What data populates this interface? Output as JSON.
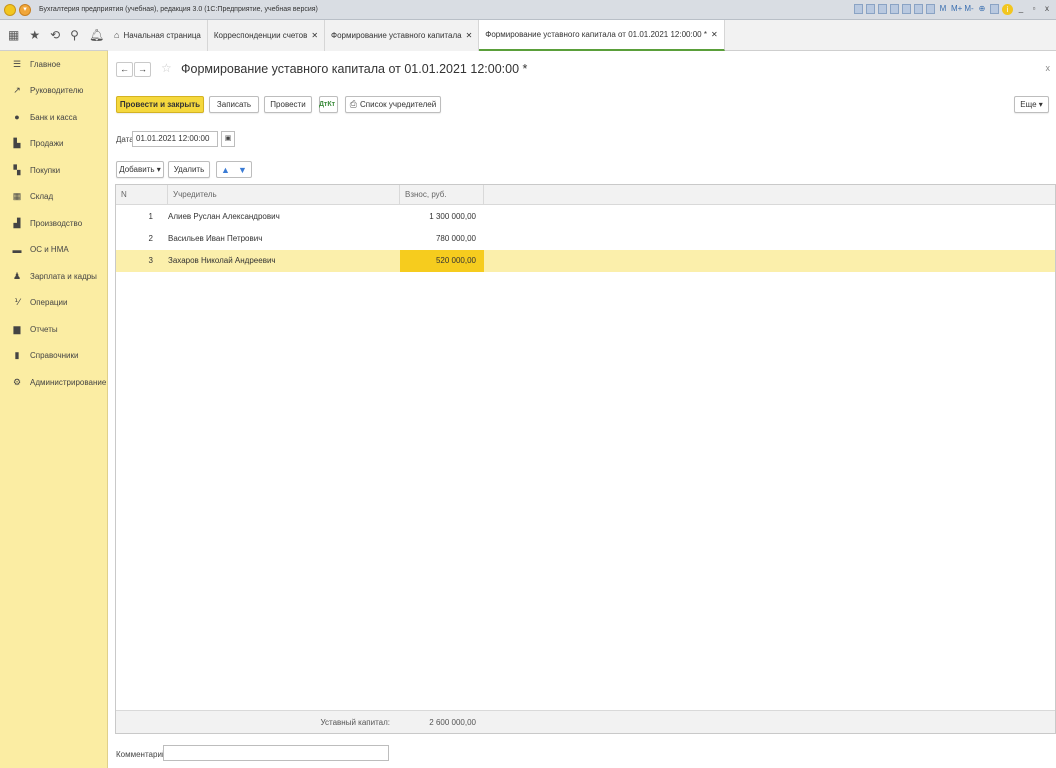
{
  "window": {
    "title": "Бухгалтерия предприятия (учебная), редакция 3.0 (1С:Предприятие, учебная версия)",
    "toolbar_icons": [
      "save-icon",
      "print-icon",
      "preview-icon",
      "link-icon",
      "copy-icon",
      "calendar-icon",
      "calc-icon",
      "M",
      "M+",
      "M-",
      "zoom-icon",
      "window-icon",
      "info-icon"
    ],
    "memory_labels": [
      "M",
      "M+",
      "M-"
    ],
    "minimize": "_",
    "restore": "▫",
    "close": "x"
  },
  "tabs": [
    {
      "label": "Начальная страница",
      "closable": false,
      "active": false
    },
    {
      "label": "Корреспонденции счетов",
      "closable": true,
      "active": false
    },
    {
      "label": "Формирование уставного капитала",
      "closable": true,
      "active": false
    },
    {
      "label": "Формирование уставного капитала от 01.01.2021 12:00:00 *",
      "closable": true,
      "active": true
    }
  ],
  "sidebar": {
    "items": [
      {
        "label": "Главное",
        "icon": "menu-lines-icon"
      },
      {
        "label": "Руководителю",
        "icon": "trend-icon"
      },
      {
        "label": "Банк и касса",
        "icon": "coin-icon"
      },
      {
        "label": "Продажи",
        "icon": "bag-icon"
      },
      {
        "label": "Покупки",
        "icon": "cart-icon"
      },
      {
        "label": "Склад",
        "icon": "warehouse-icon"
      },
      {
        "label": "Производство",
        "icon": "factory-icon"
      },
      {
        "label": "ОС и НМА",
        "icon": "truck-icon"
      },
      {
        "label": "Зарплата и кадры",
        "icon": "person-icon"
      },
      {
        "label": "Операции",
        "icon": "dt-kt-icon"
      },
      {
        "label": "Отчеты",
        "icon": "bar-chart-icon"
      },
      {
        "label": "Справочники",
        "icon": "book-icon"
      },
      {
        "label": "Администрирование",
        "icon": "gear-icon"
      }
    ]
  },
  "form": {
    "title": "Формирование уставного капитала от 01.01.2021 12:00:00 *",
    "close": "x",
    "buttons": {
      "post_close": "Провести и закрыть",
      "save": "Записать",
      "post": "Провести",
      "dtkt": "ДтКт",
      "founders_list": "Список учредителей",
      "more": "Еще ▾"
    },
    "date_label": "Дата:",
    "date_value": "01.01.2021 12:00:00",
    "table_buttons": {
      "add": "Добавить ▾",
      "delete": "Удалить"
    },
    "table": {
      "columns": [
        "N",
        "Учредитель",
        "Взнос, руб."
      ],
      "rows": [
        {
          "n": "1",
          "name": "Алиев Руслан Александрович",
          "amount": "1 300 000,00"
        },
        {
          "n": "2",
          "name": "Васильев Иван Петрович",
          "amount": "780 000,00"
        },
        {
          "n": "3",
          "name": "Захаров Николай Андреевич",
          "amount": "520 000,00"
        }
      ],
      "selected_row": 3,
      "footer_label": "Уставный капитал:",
      "footer_total": "2 600 000,00"
    },
    "comment_label": "Комментарий:",
    "comment_value": ""
  },
  "colors": {
    "sidebar_bg": "#fbeda3",
    "primary_button": "#f5d83d",
    "selected_row": "#fbefab",
    "selected_cell": "#f6cc1e",
    "active_tab_underline": "#5a9f3a"
  }
}
